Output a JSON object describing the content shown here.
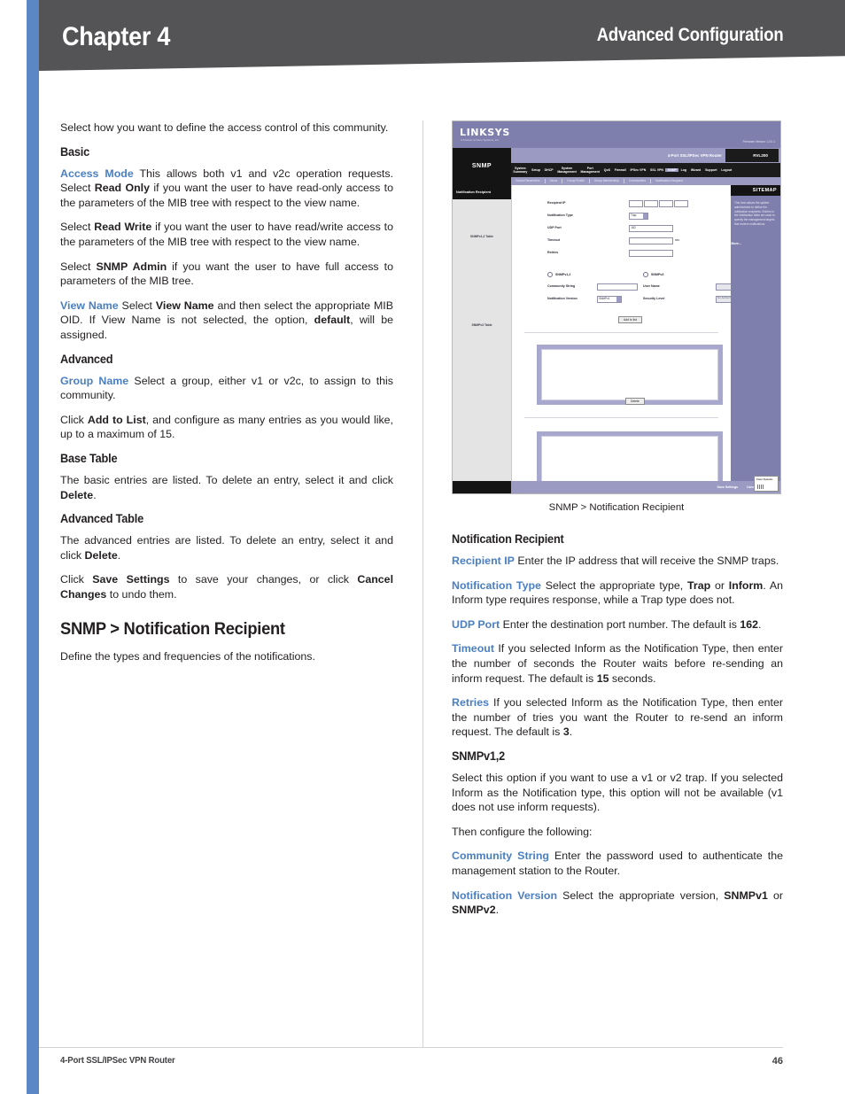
{
  "header": {
    "chapter": "Chapter 4",
    "subject": "Advanced Configuration"
  },
  "footer": {
    "product": "4-Port SSL/IPSec VPN Router",
    "page_number": "46"
  },
  "left_column": {
    "intro": "Select how you want to define the access control of this community.",
    "basic_heading": "Basic",
    "access_mode": {
      "term": "Access Mode",
      "text_1": " This allows both v1 and v2c operation requests. Select ",
      "bold_1": "Read Only",
      "text_2": " if you want the user to have read-only access to the parameters of the MIB tree with respect to the view name."
    },
    "read_write": {
      "text_1": "Select ",
      "bold_1": "Read Write",
      "text_2": " if you want the user to have read/write access to the parameters of the MIB tree with respect to the view name."
    },
    "snmp_admin": {
      "text_1": "Select ",
      "bold_1": "SNMP Admin",
      "text_2": " if you want the user to have full access to parameters of the MIB tree."
    },
    "view_name": {
      "term": "View Name",
      "text_1": " Select ",
      "bold_1": "View Name",
      "text_2": " and then select the appropriate MIB OID. If View Name is not selected, the option, ",
      "bold_2": "default",
      "text_3": ", will be assigned."
    },
    "advanced_heading": "Advanced",
    "group_name": {
      "term": "Group Name",
      "text_1": "  Select a group, either v1 or v2c, to assign to this community."
    },
    "add_to_list": {
      "text_1": "Click ",
      "bold_1": "Add to List",
      "text_2": ", and configure as many entries as you would like, up to a maximum of 15."
    },
    "base_table_heading": "Base Table",
    "base_table": {
      "text_1": "The basic entries are listed. To delete an entry, select it and click ",
      "bold_1": "Delete",
      "text_2": "."
    },
    "advanced_table_heading": "Advanced Table",
    "advanced_table": {
      "text_1": "The advanced entries are listed. To delete an entry, select it and click ",
      "bold_1": "Delete",
      "text_2": "."
    },
    "save_cancel": {
      "text_1": "Click ",
      "bold_1": "Save Settings",
      "text_2": " to save your changes, or click ",
      "bold_2": "Cancel Changes",
      "text_3": " to undo them."
    },
    "section_heading": "SNMP > Notification Recipient",
    "section_intro": "Define the types and frequencies of the notifications."
  },
  "figure": {
    "caption": "SNMP > Notification Recipient",
    "screenshot": {
      "brand": "LINKSYS",
      "brand_sub": "A Division of Cisco Systems, Inc.",
      "firmware": "Firmware Version: 1.0.0.1",
      "model_name": "4-Port SSL/IPSec VPN Router",
      "model_number": "RVL200",
      "section_label": "SNMP",
      "page_label": "Notification Recipient",
      "nav_items": [
        "System\nSummary",
        "Setup",
        "DHCP",
        "System\nManagement",
        "Port\nManagement",
        "QoS",
        "Firewall",
        "IPSec VPN",
        "SSL VPN",
        "SNMP",
        "Log",
        "Wizard",
        "Support",
        "Logout"
      ],
      "nav_active": "SNMP",
      "subnav_items": [
        "Global Parameters",
        "Views",
        "Group Profile",
        "Group Membership",
        "Communities",
        "Notification Recipient"
      ],
      "form": {
        "recipient_ip_label": "Recipient IP",
        "notification_type_label": "Notification Type",
        "notification_type_value": "Trap",
        "udp_port_label": "UDP Port",
        "udp_port_value": "162",
        "timeout_label": "Timeout",
        "timeout_unit": "sec.",
        "retries_label": "Retries",
        "snmpv12_radio": "SNMPv1,2",
        "snmpv3_radio": "SNMPv3",
        "community_string_label": "Community String",
        "notification_version_label": "Notification Version",
        "notification_version_value": "SNMPv1",
        "user_name_label": "User Name",
        "security_level_label": "Security Level",
        "security_level_value": "No Authentication",
        "add_to_list_button": "Add to list"
      },
      "tables": {
        "v12_label": "SNMPv1,2 Table",
        "v3_label": "SNMPv3 Table",
        "delete_button": "Delete"
      },
      "footer_buttons": [
        "Save Settings",
        "Cancel Changes"
      ],
      "sitemap_label": "SITEMAP",
      "help_text": "This form allows the system administrator to define the notification recipients. Entries in the Notification table are used to specify the management targets that receive notifications.",
      "help_more": "More...",
      "cisco_label": "Cisco Systems"
    }
  },
  "right_column": {
    "heading": "Notification Recipient",
    "recipient_ip": {
      "term": "Recipient IP",
      "text_1": "  Enter the IP address that will receive the SNMP traps."
    },
    "notification_type": {
      "term": "Notification Type",
      "text_1": " Select the appropriate type, ",
      "bold_1": "Trap",
      "text_2": " or ",
      "bold_2": "Inform",
      "text_3": ". An Inform type requires response, while a Trap type does not."
    },
    "udp_port": {
      "term": "UDP Port",
      "text_1": "  Enter the destination port number. The default is ",
      "bold_1": "162",
      "text_2": "."
    },
    "timeout": {
      "term": "Timeout",
      "text_1": "  If you selected Inform as the Notification Type, then enter the number of seconds the Router waits before re-sending an inform request. The default is ",
      "bold_1": "15",
      "text_2": " seconds."
    },
    "retries": {
      "term": "Retries",
      "text_1": "  If you selected Inform as the Notification Type, then enter the number of tries you want the Router to re-send an inform request. The default is ",
      "bold_1": "3",
      "text_2": "."
    },
    "snmpv12_heading": "SNMPv1,2",
    "snmpv12_text": "Select this option if you want to use a v1 or v2 trap. If you selected Inform as the Notification type, this option will not be available (v1 does not use inform requests).",
    "then_configure": "Then configure the following:",
    "community_string": {
      "term": "Community String",
      "text_1": " Enter the password used to authenticate the management station to the Router."
    },
    "notification_version": {
      "term": "Notification Version",
      "text_1": " Select the appropriate version, ",
      "bold_1": "SNMPv1",
      "text_2": " or ",
      "bold_2": "SNMPv2",
      "text_3": "."
    }
  }
}
